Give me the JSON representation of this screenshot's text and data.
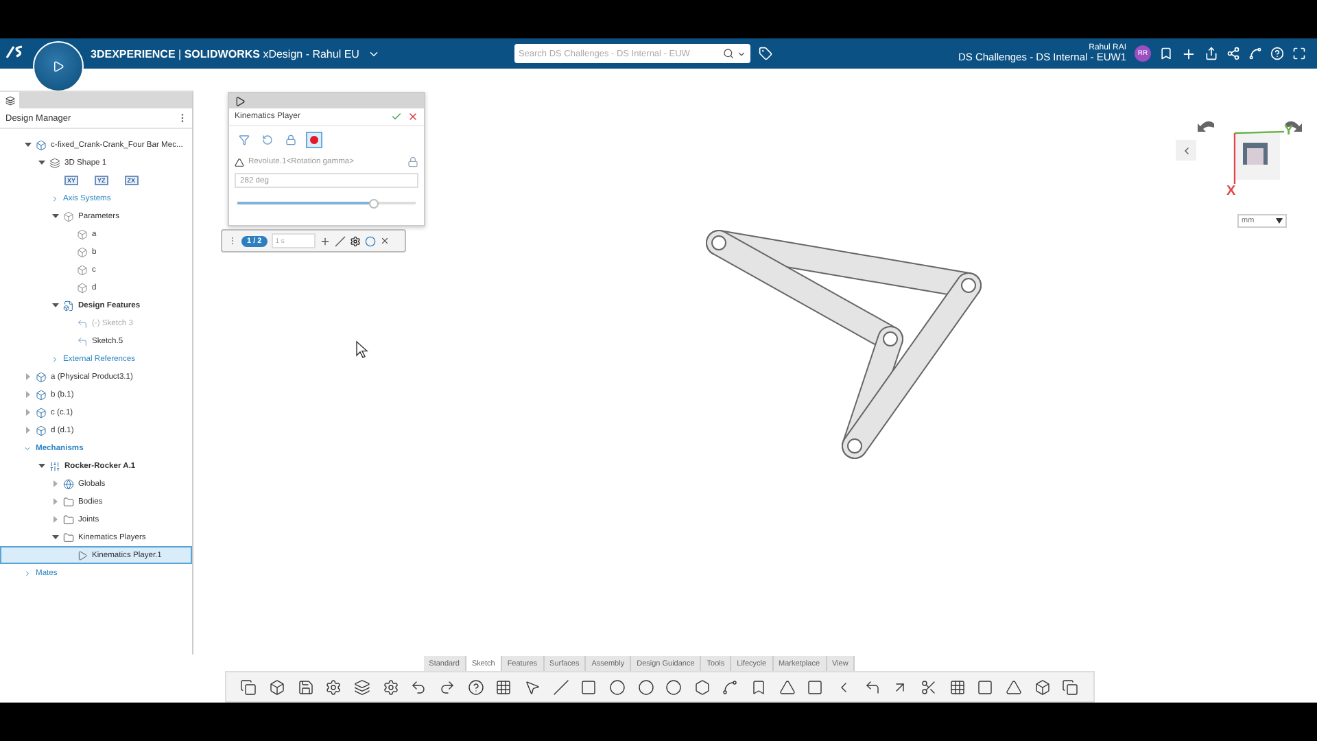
{
  "header": {
    "brand": "3DEXPERIENCE",
    "separator": "|",
    "product": "SOLIDWORKS",
    "app": "xDesign - Rahul EU",
    "search_placeholder": "Search DS Challenges - DS Internal - EUW",
    "user": "Rahul RAI",
    "tenant": "DS Challenges - DS Internal - EUW1",
    "avatar": "RR"
  },
  "panel": {
    "title": "Design Manager",
    "tree": [
      {
        "label": "c-fixed_Crank-Crank_Four Bar Mec...",
        "kind": "part",
        "expanded": true,
        "selected": false,
        "children": [
          {
            "label": "3D Shape 1",
            "kind": "shape",
            "expanded": true,
            "selected": false,
            "planes": [
              "XY",
              "YZ",
              "ZX"
            ],
            "children": [
              {
                "label": "Axis Systems",
                "kind": "section",
                "expanded": false,
                "selected": false
              },
              {
                "label": "Parameters",
                "kind": "params",
                "expanded": true,
                "selected": false,
                "children": [
                  {
                    "label": "a",
                    "kind": "param",
                    "selected": false
                  },
                  {
                    "label": "b",
                    "kind": "param",
                    "selected": false
                  },
                  {
                    "label": "c",
                    "kind": "param",
                    "selected": false
                  },
                  {
                    "label": "d",
                    "kind": "param",
                    "selected": false
                  }
                ]
              },
              {
                "label": "Design Features",
                "kind": "features",
                "expanded": true,
                "selected": false,
                "children": [
                  {
                    "label": "(-)  Sketch 3",
                    "kind": "sketch",
                    "disabled": true,
                    "selected": false
                  },
                  {
                    "label": "Sketch.5",
                    "kind": "sketch",
                    "disabled": false,
                    "selected": false
                  }
                ]
              },
              {
                "label": "External References",
                "kind": "section",
                "expanded": false,
                "selected": false
              }
            ]
          }
        ]
      },
      {
        "label": "a (Physical Product3.1)",
        "kind": "part",
        "expanded": false,
        "selected": false
      },
      {
        "label": "b (b.1)",
        "kind": "part",
        "expanded": false,
        "selected": false
      },
      {
        "label": "c (c.1)",
        "kind": "part",
        "expanded": false,
        "selected": false
      },
      {
        "label": "d (d.1)",
        "kind": "part",
        "expanded": false,
        "selected": false
      },
      {
        "label": "Mechanisms",
        "kind": "section",
        "expanded": true,
        "selected": false,
        "children": [
          {
            "label": "Rocker-Rocker A.1",
            "kind": "mechanism",
            "expanded": true,
            "selected": false,
            "children": [
              {
                "label": "Globals",
                "kind": "globe",
                "expanded": false,
                "selected": false
              },
              {
                "label": "Bodies",
                "kind": "folder",
                "expanded": false,
                "selected": false
              },
              {
                "label": "Joints",
                "kind": "folder",
                "expanded": false,
                "selected": false
              },
              {
                "label": "Kinematics Players",
                "kind": "folder",
                "expanded": true,
                "selected": false,
                "children": [
                  {
                    "label": "Kinematics Player.1",
                    "kind": "player",
                    "selected": true
                  }
                ]
              }
            ]
          }
        ]
      },
      {
        "label": "Mates",
        "kind": "section",
        "expanded": false,
        "selected": false
      }
    ]
  },
  "dialog": {
    "title": "Kinematics Player",
    "record": true,
    "joint": "Revolute.1<Rotation gamma>",
    "value": "282 deg",
    "level": 0.76
  },
  "playbar": {
    "step": "1 / 2",
    "duration": "1 s"
  },
  "viewcube": {
    "x_axis": "X",
    "y_axis": "Y",
    "units": "mm"
  },
  "toolbar": {
    "tabs": [
      {
        "label": "Standard",
        "selected": false
      },
      {
        "label": "Sketch",
        "selected": true
      },
      {
        "label": "Features",
        "selected": false
      },
      {
        "label": "Surfaces",
        "selected": false
      },
      {
        "label": "Assembly",
        "selected": false
      },
      {
        "label": "Design Guidance",
        "selected": false
      },
      {
        "label": "Tools",
        "selected": false
      },
      {
        "label": "Lifecycle",
        "selected": false
      },
      {
        "label": "Marketplace",
        "selected": false
      },
      {
        "label": "View",
        "selected": false
      }
    ]
  }
}
